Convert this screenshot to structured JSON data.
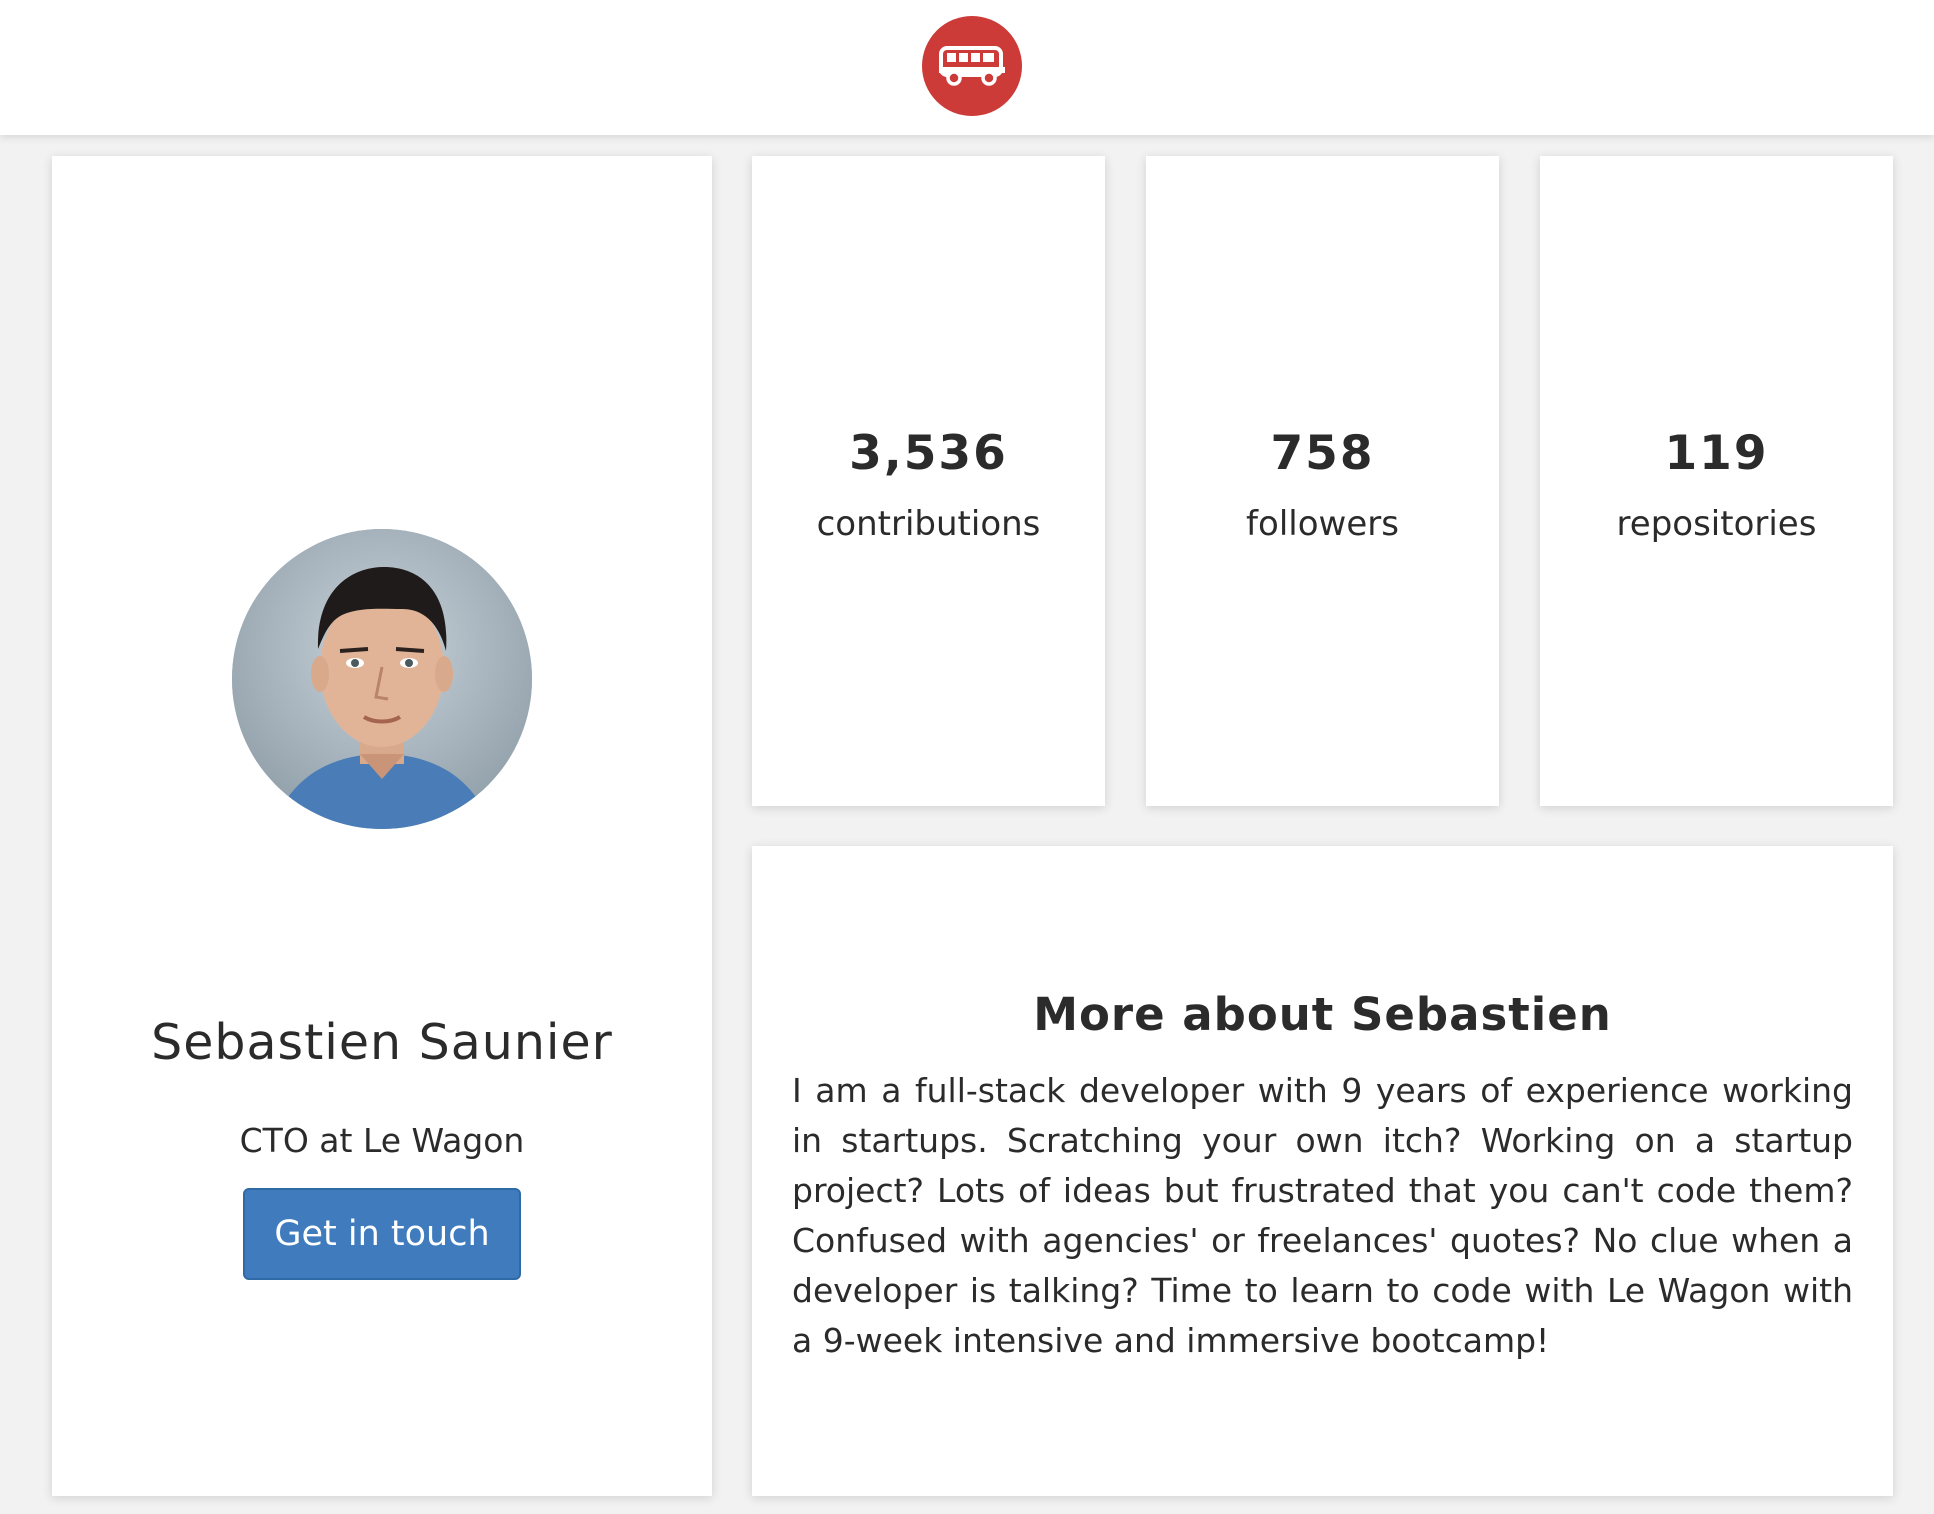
{
  "navbar": {
    "logo_icon": "van-icon",
    "logo_color": "#cc3b37"
  },
  "profile": {
    "avatar_alt": "profile-photo",
    "name": "Sebastien Saunier",
    "title": "CTO at Le Wagon",
    "button_label": "Get in touch",
    "button_color": "#3f7bbd"
  },
  "stats": [
    {
      "value": "3,536",
      "label": "contributions"
    },
    {
      "value": "758",
      "label": "followers"
    },
    {
      "value": "119",
      "label": "repositories"
    }
  ],
  "about": {
    "title": "More about Sebastien",
    "text": "I am a full-stack developer with 9 years of experience working in startups. Scratching your own itch? Working on a startup project? Lots of ideas but frustrated that you can't code them? Confused with agencies' or freelances' quotes? No clue when a developer is talking? Time to learn to code with Le Wagon with a 9-week intensive and immersive bootcamp!"
  }
}
